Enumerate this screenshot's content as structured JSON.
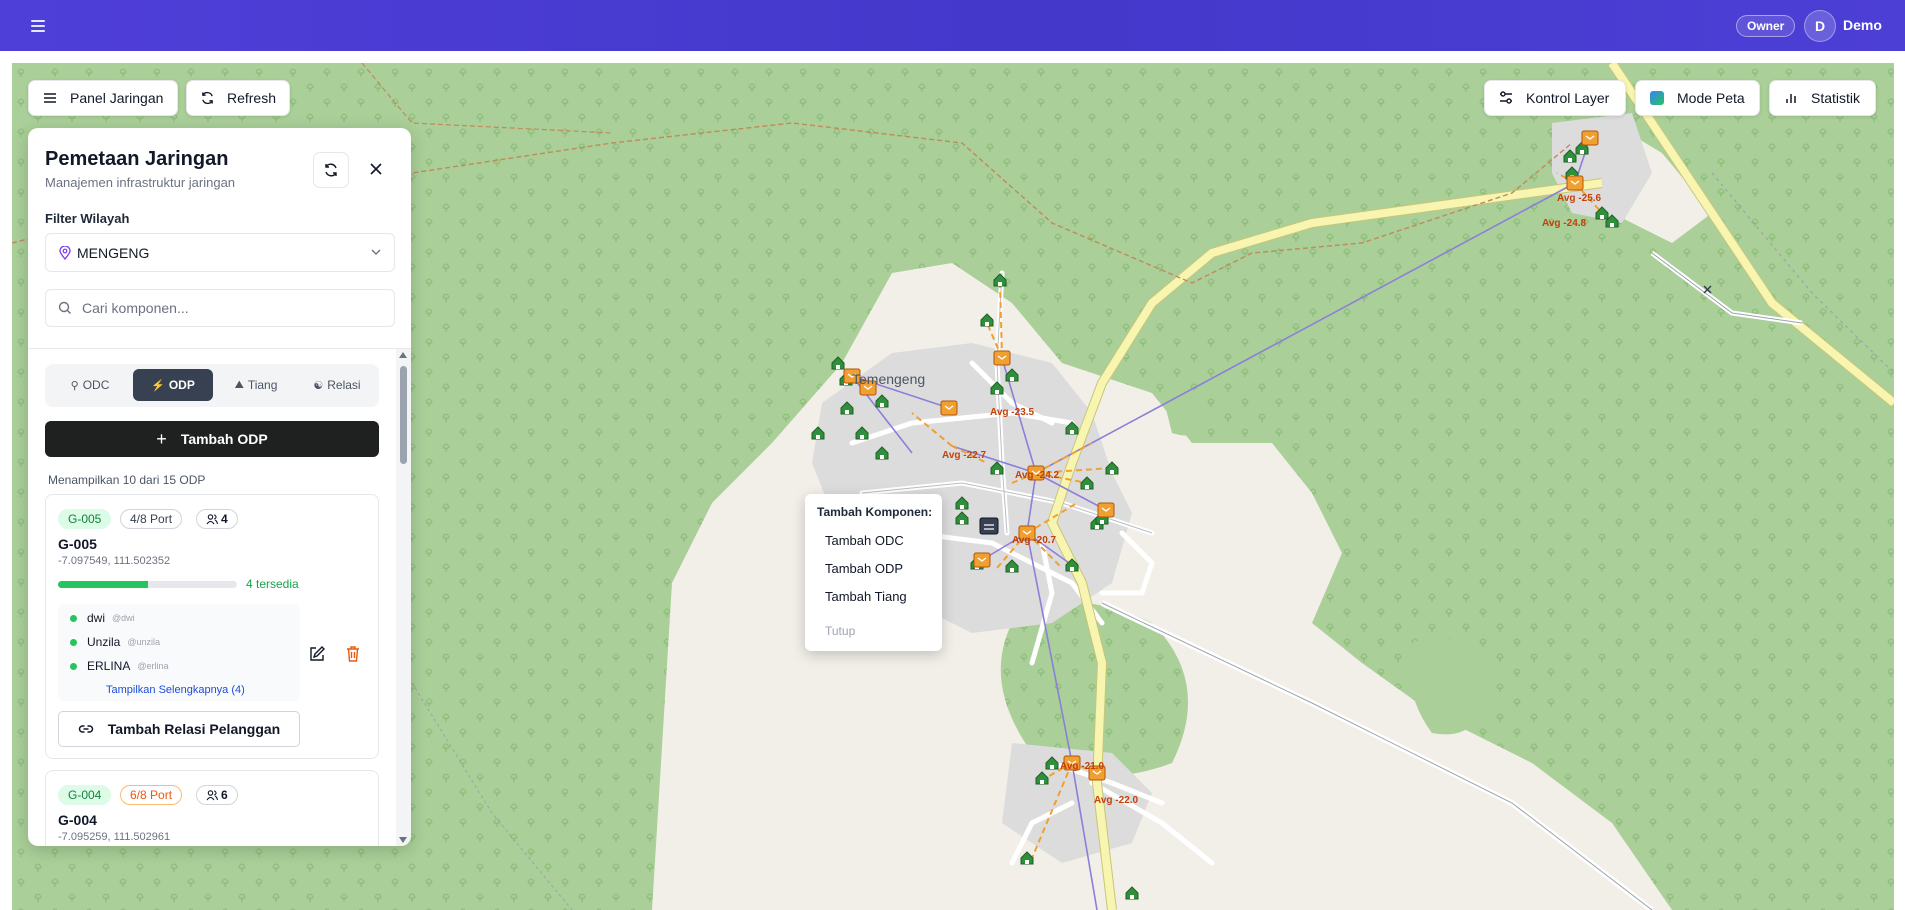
{
  "header": {
    "role_badge": "Owner",
    "avatar_initial": "D",
    "username": "Demo"
  },
  "toolbar": {
    "panel_button": "Panel Jaringan",
    "refresh_button": "Refresh",
    "layer_button": "Kontrol Layer",
    "map_mode_button": "Mode Peta",
    "stats_button": "Statistik"
  },
  "panel": {
    "title": "Pemetaan Jaringan",
    "subtitle": "Manajemen infrastruktur jaringan",
    "filter_label": "Filter Wilayah",
    "region_selected": "MENGENG",
    "search_placeholder": "Cari komponen...",
    "tabs": [
      {
        "label": "ODC",
        "icon": "network-icon",
        "active": false
      },
      {
        "label": "ODP",
        "icon": "bolt-icon",
        "active": true
      },
      {
        "label": "Tiang",
        "icon": "pole-icon",
        "active": false
      },
      {
        "label": "Relasi",
        "icon": "users-icon",
        "active": false
      }
    ],
    "add_button": "Tambah ODP",
    "count_text": "Menampilkan 10 dari 15 ODP",
    "cards": [
      {
        "id": "G-005",
        "ports": "4/8 Port",
        "users": "4",
        "name": "G-005",
        "coords": "-7.097549, 111.502352",
        "used_fraction": 0.5,
        "available": "4 tersedia",
        "customers": [
          {
            "name": "dwi",
            "handle": "@dwi"
          },
          {
            "name": "Unzila",
            "handle": "@unzila"
          },
          {
            "name": "ERLINA",
            "handle": "@erlina"
          }
        ],
        "show_more": "Tampilkan Selengkapnya (4)",
        "relation_button": "Tambah Relasi Pelanggan"
      },
      {
        "id": "G-004",
        "ports": "6/8 Port",
        "users": "6",
        "name": "G-004",
        "coords": "-7.095259, 111.502961"
      }
    ]
  },
  "context_menu": {
    "title": "Tambah Komponen:",
    "items": [
      "Tambah ODC",
      "Tambah ODP",
      "Tambah Tiang"
    ],
    "close": "Tutup"
  },
  "map": {
    "town_label": "Temengeng",
    "odp_labels": [
      "Avg -25.6",
      "Avg -24.8",
      "Avg -23.5",
      "Avg -22.7",
      "Avg -24.2",
      "Avg -20.7",
      "Avg -21.0",
      "Avg -22.0"
    ],
    "colors": {
      "forest": "#aacf98",
      "settlement": "#dcdcdc",
      "open_land": "#f2efe9",
      "main_road": "#f7f5b0",
      "fiber_link": "#8b7fd9",
      "drop_cable": "#f0a030",
      "odp_marker": "#f0a030"
    }
  }
}
